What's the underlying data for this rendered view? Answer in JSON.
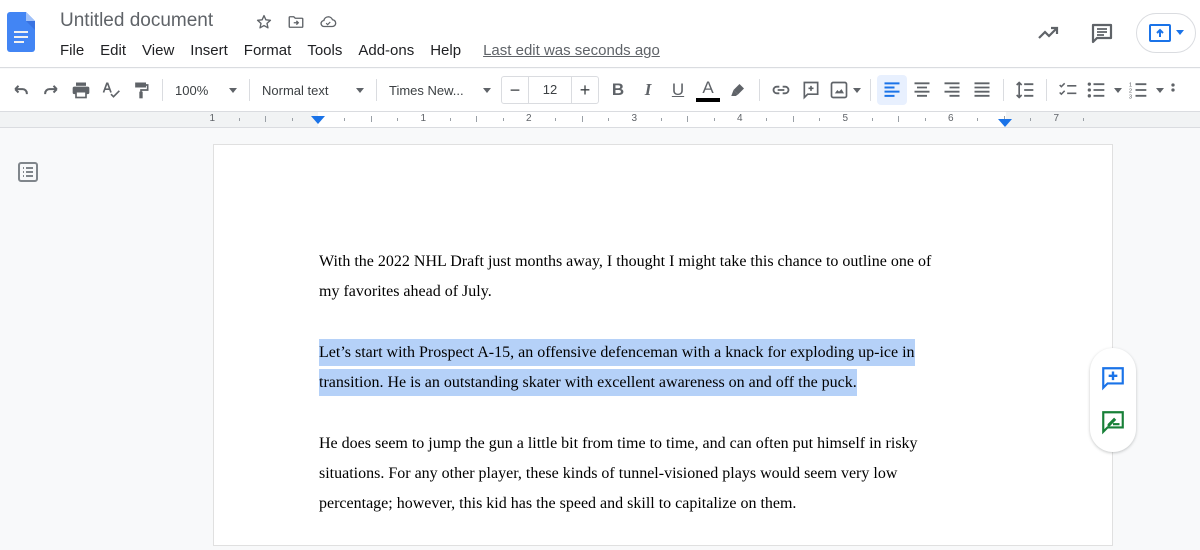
{
  "app": {
    "name": "Google Docs",
    "document_title": "Untitled document"
  },
  "header": {
    "title_icons": [
      "star-icon",
      "move-to-folder-icon",
      "cloud-saved-icon"
    ],
    "menu": [
      "File",
      "Edit",
      "View",
      "Insert",
      "Format",
      "Tools",
      "Add-ons",
      "Help"
    ],
    "last_edit": "Last edit was seconds ago",
    "right_icons": [
      "activity-trend-icon",
      "comments-icon",
      "present-icon"
    ]
  },
  "toolbar": {
    "zoom": "100%",
    "paragraph_style": "Normal text",
    "font": "Times New...",
    "font_size": "12",
    "decrease_label": "−",
    "increase_label": "+",
    "bold": "B",
    "italic": "I",
    "underline": "U",
    "text_color_label": "A",
    "text_color": "#000000",
    "active_alignment": "left",
    "accent_color": "#1a73e8",
    "selected_bg": "#e8f0fe"
  },
  "ruler": {
    "labels": [
      "1",
      "1",
      "2",
      "3",
      "4",
      "5",
      "6",
      "7"
    ]
  },
  "document": {
    "paragraphs": [
      {
        "lines": [
          "With the 2022 NHL Draft just months away, I thought I might take this chance to outline one of",
          "my favorites ahead of July."
        ],
        "selected": false
      },
      {
        "lines": [
          "Let’s start with Prospect A-15, an offensive defenceman with a knack for exploding up-ice in",
          "transition. He is an outstanding skater with excellent awareness on and off the puck."
        ],
        "selected": true
      },
      {
        "lines": [
          "He does seem to jump the gun a little bit from time to time, and can often put himself in risky",
          "situations. For any other player, these kinds of tunnel-visioned plays would seem very low",
          "percentage; however, this kid has the speed and skill to capitalize on them."
        ],
        "selected": false
      }
    ],
    "selection_color": "#b5d1f8"
  },
  "side_actions": [
    "add-comment-icon",
    "suggest-edits-icon"
  ]
}
